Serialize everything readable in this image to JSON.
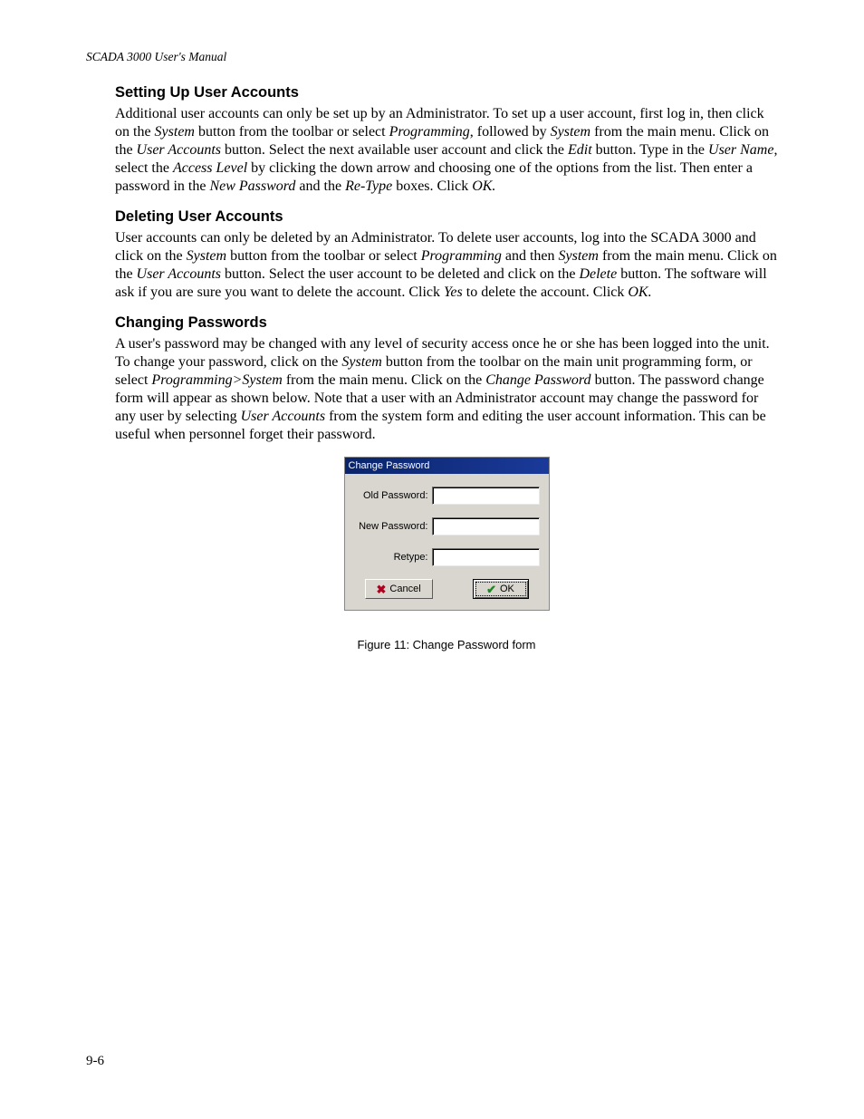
{
  "header": "SCADA 3000 User's Manual",
  "sections": {
    "setup": {
      "heading": "Setting Up User Accounts",
      "body_html": "Additional user accounts can only be set up by an Administrator. To set up a user account, first log in, then click on the <em>System</em> button from the toolbar or select <em>Programming</em>, followed by <em>System</em> from the main menu. Click on the <em>User Accounts</em> button. Select the next available user account and click the <em>Edit</em> button. Type in the <em>User Name</em>, select the <em>Access Level</em> by clicking the down arrow and choosing one of the options from the list. Then enter a password in the <em>New Password</em> and the <em>Re-Type</em> boxes.  Click <em>OK.</em>"
    },
    "delete": {
      "heading": "Deleting User Accounts",
      "body_html": "User accounts can only be deleted by an Administrator. To delete user accounts, log into the SCADA 3000 and click on the <em>System</em> button from the toolbar or select <em>Programming</em> and then <em>System</em> from the main menu. Click on the <em>User Accounts</em> button. Select the user account to be deleted and click on the <em>Delete</em> button. The software will ask if you are sure you want to delete the account. Click <em>Yes</em> to delete the account.  Click <em>OK.</em>"
    },
    "change": {
      "heading": "Changing Passwords",
      "body_html": "A user's password may be changed with any level of security access once he or she has been logged into the unit. To change your password, click on the <em>System</em> button from the toolbar on the main unit programming form, or select <em>Programming>System</em> from the main menu. Click on the <em>Change Password</em> button. The password change form will appear as shown below.  Note that a user with an Administrator account may change the password for any user by selecting <em>User Accounts</em> from the system form and editing the user account information. This can be useful when personnel forget their password."
    }
  },
  "dialog": {
    "title": "Change Password",
    "fields": {
      "old": "Old Password:",
      "new": "New Password:",
      "retype": "Retype:"
    },
    "buttons": {
      "cancel": "Cancel",
      "ok": "OK"
    }
  },
  "figure_caption": "Figure 11: Change Password form",
  "page_number": "9-6"
}
